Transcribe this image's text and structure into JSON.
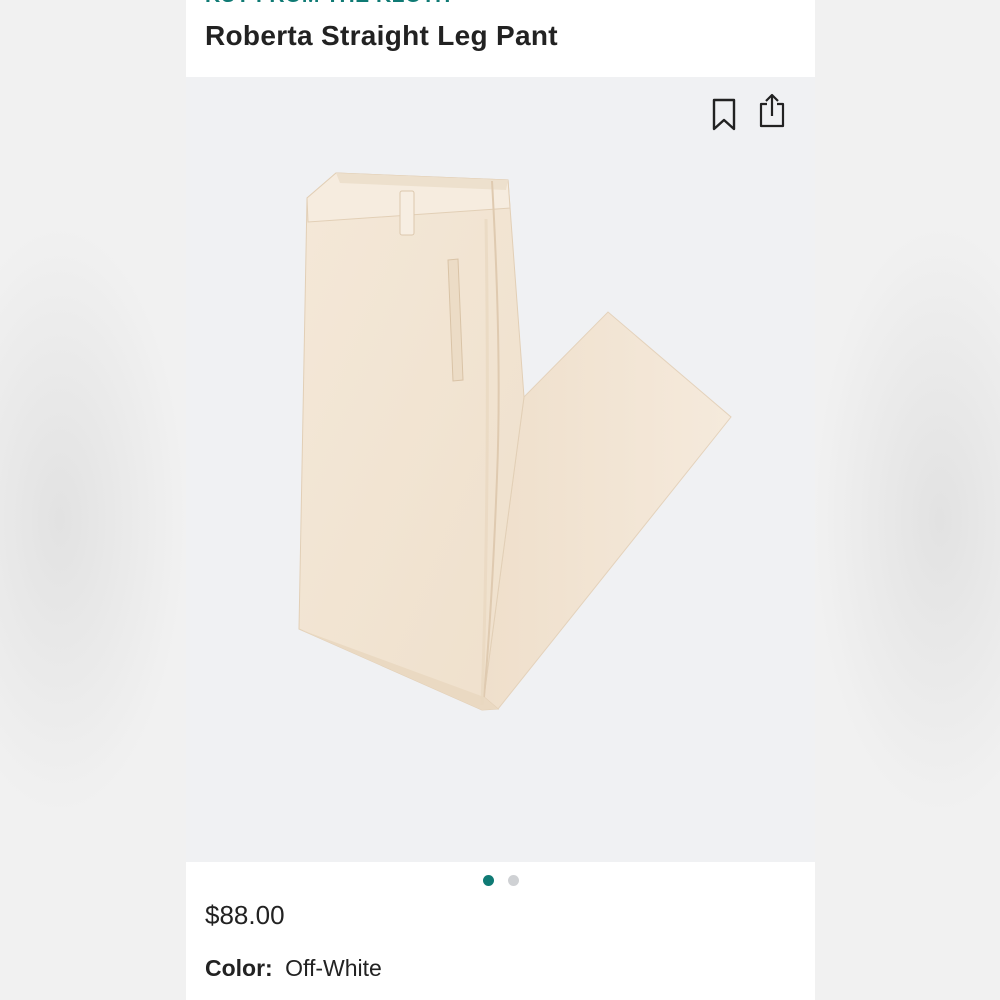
{
  "product": {
    "brand": "KUT FROM THE KLOTH",
    "name": "Roberta Straight Leg Pant",
    "price": "$88.00",
    "color_label": "Color:",
    "color_value": "Off-White"
  },
  "gallery": {
    "image_count": 2,
    "active_index": 0,
    "image_description": "pants-photo"
  },
  "actions": {
    "save_icon": "bookmark-icon",
    "share_icon": "share-icon"
  },
  "colors": {
    "brand_accent": "#0f7a74",
    "pant_fabric": "#f3e6d5",
    "gallery_bg": "#f0f1f3"
  }
}
